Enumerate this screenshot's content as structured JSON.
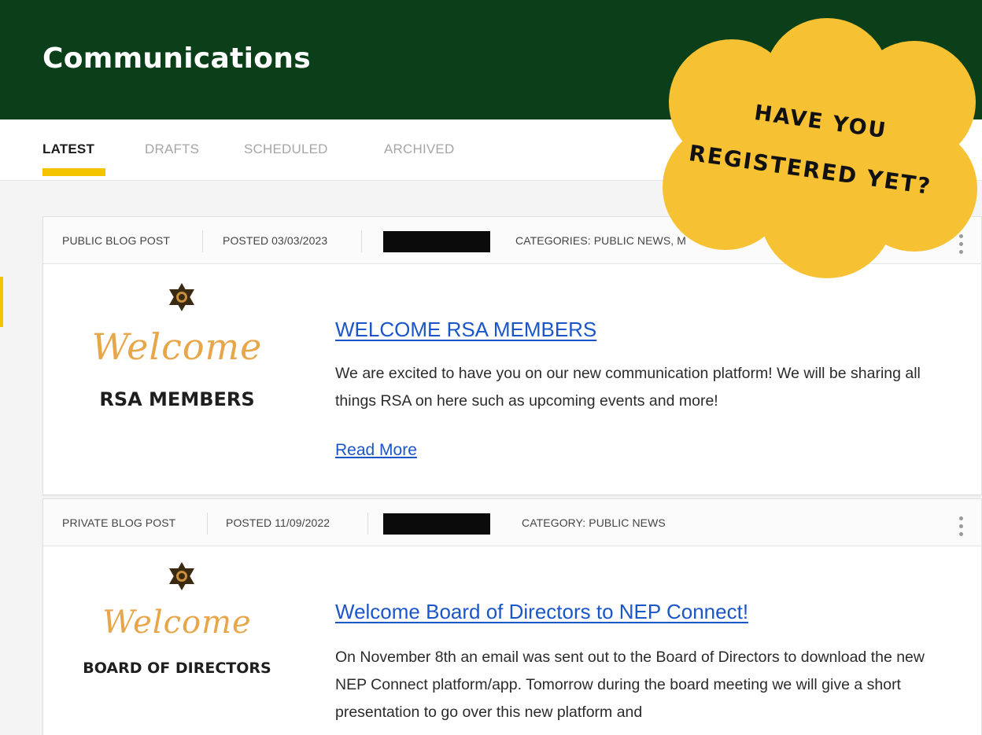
{
  "header": {
    "title": "Communications"
  },
  "tabs": [
    {
      "label": "LATEST"
    },
    {
      "label": "DRAFTS"
    },
    {
      "label": "SCHEDULED"
    },
    {
      "label": "ARCHIVED"
    }
  ],
  "promo": {
    "line1": "Have you",
    "line2": "registered yet?",
    "color": "#f6c132"
  },
  "posts": [
    {
      "type": "PUBLIC BLOG POST",
      "posted": "POSTED 03/03/2023",
      "categories": "CATEGORIES: PUBLIC NEWS, M",
      "thumb_script": "Welcome",
      "thumb_caption": "RSA MEMBERS",
      "title": "WELCOME RSA MEMBERS",
      "body": "We are excited to have you on our new communication platform! We will be sharing all things RSA on here such as upcoming events and more!",
      "read_more": "Read More"
    },
    {
      "type": "PRIVATE BLOG POST",
      "posted": "POSTED 11/09/2022",
      "categories": "CATEGORY: PUBLIC NEWS",
      "thumb_script": "Welcome",
      "thumb_caption": "BOARD OF DIRECTORS",
      "title": "Welcome Board of Directors to NEP Connect!",
      "body": "On November 8th an email was sent out to the Board of Directors to download the new NEP Connect platform/app. Tomorrow during the board meeting we will give a short presentation to go over this new platform and"
    }
  ],
  "colors": {
    "header_bg": "#0b3f1a",
    "accent": "#f5c400",
    "link": "#1a56c9"
  }
}
